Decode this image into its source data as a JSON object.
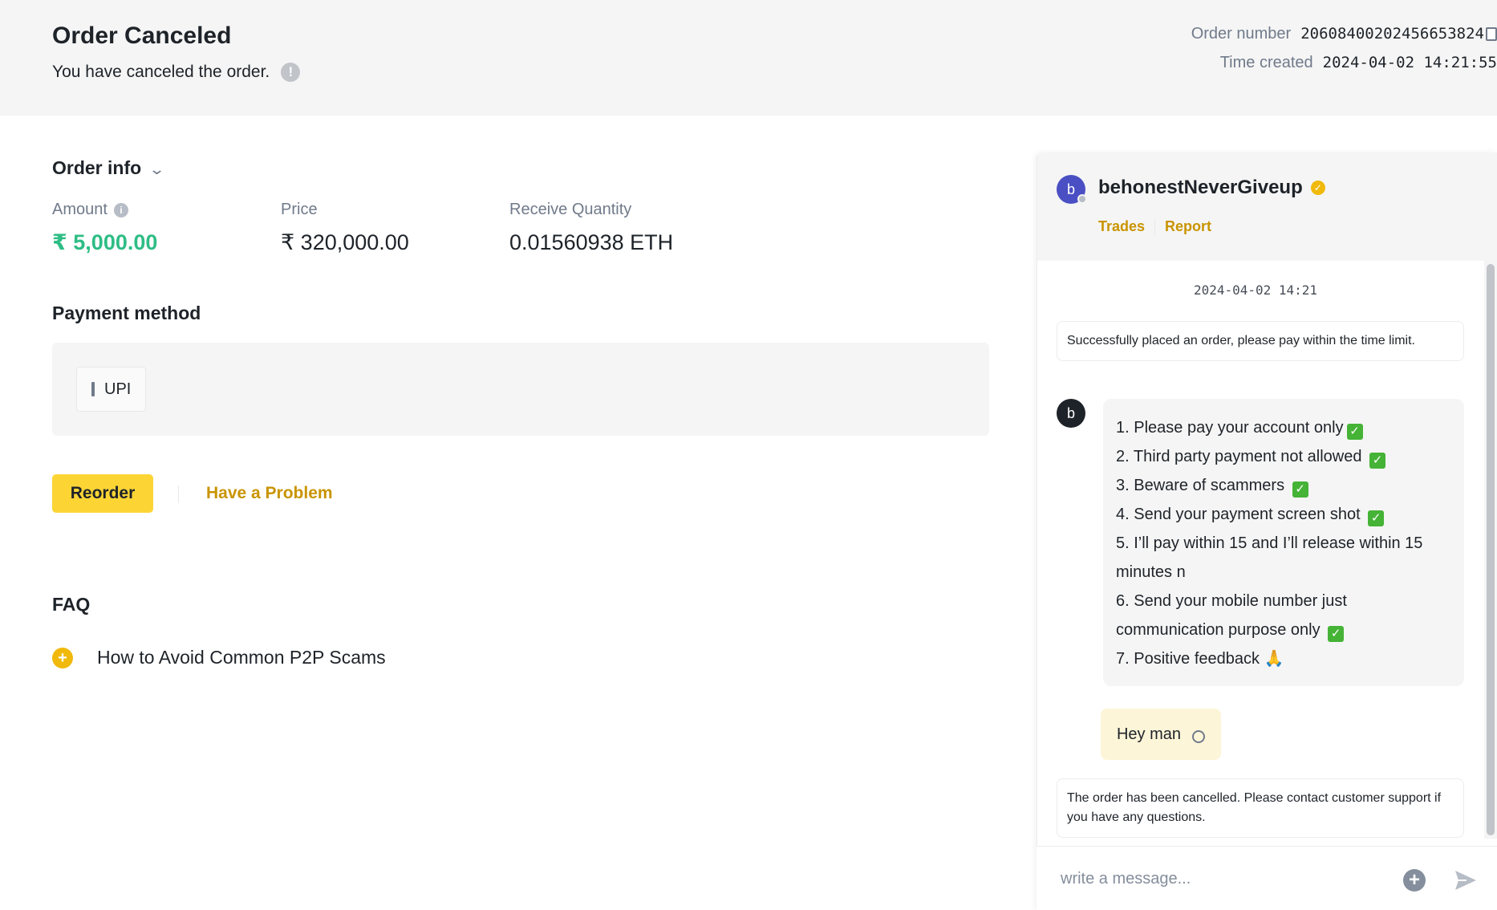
{
  "header": {
    "title": "Order Canceled",
    "subtitle": "You have canceled the order.",
    "order_number_label": "Order number",
    "order_number": "20608400202456653824",
    "time_created_label": "Time created",
    "time_created": "2024-04-02 14:21:55"
  },
  "order_info": {
    "title": "Order info",
    "amount_label": "Amount",
    "amount": "₹ 5,000.00",
    "price_label": "Price",
    "price": "₹ 320,000.00",
    "quantity_label": "Receive Quantity",
    "quantity": "0.01560938 ETH"
  },
  "payment": {
    "title": "Payment method",
    "method": "UPI"
  },
  "actions": {
    "reorder": "Reorder",
    "problem": "Have a Problem"
  },
  "faq": {
    "title": "FAQ",
    "items": [
      {
        "label": "How to Avoid Common P2P Scams"
      }
    ]
  },
  "chat": {
    "avatar_letter": "b",
    "name": "behonestNeverGiveup",
    "trades_link": "Trades",
    "report_link": "Report",
    "timestamp": "2024-04-02 14:21",
    "system_msg_1": "Successfully placed an order, please pay within the time limit.",
    "bot_avatar_letter": "b",
    "rules": [
      "1. Please pay your account only",
      "2. Third party payment not allowed ",
      "3. Beware of scammers ",
      "4. Send your payment screen shot ",
      "5. I’ll pay within 15 and I’ll release within 15 minutes n",
      "6. Send your mobile number just communication purpose only ",
      "7. Positive feedback 🙏"
    ],
    "user_msg": "Hey man",
    "system_msg_2": "The order has been cancelled. Please contact customer support if you have any questions.",
    "input_placeholder": "write a message..."
  },
  "colors": {
    "accent_yellow": "#fcd535",
    "link_gold": "#c99400",
    "amount_green": "#2ebd85",
    "check_green": "#45b336"
  },
  "icons": {
    "subtitle_icon": "exclamation-circle-icon",
    "order_number_copy": "copy-icon",
    "order_info_toggle": "chevron-down-icon",
    "amount_info": "info-icon",
    "faq_expand": "plus-circle-icon",
    "verified": "verified-badge-icon",
    "message_status": "pending-circle-icon",
    "chat_add": "plus-circle-icon",
    "chat_send": "send-icon"
  }
}
